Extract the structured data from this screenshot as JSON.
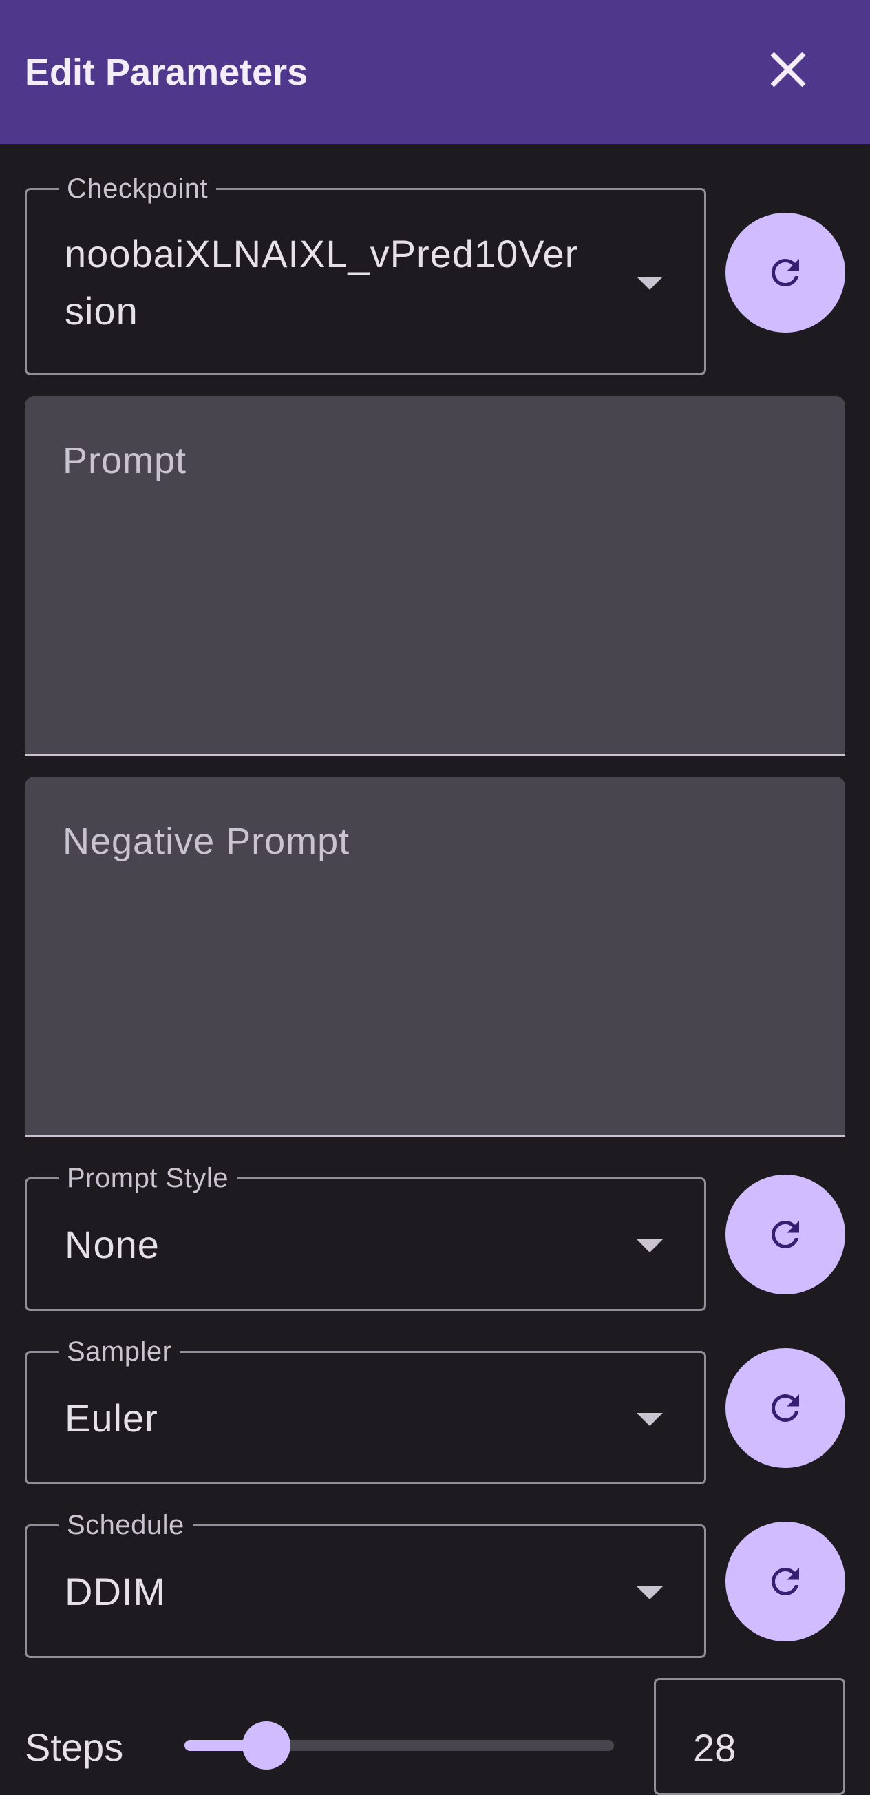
{
  "dialog": {
    "title": "Edit Parameters",
    "close_icon": "close-icon"
  },
  "checkpoint": {
    "label": "Checkpoint",
    "value_line1": "noobaiXLNAIXL_vPred10Ver",
    "value_line2": "sion"
  },
  "prompt": {
    "placeholder": "Prompt"
  },
  "negative_prompt": {
    "placeholder": "Negative Prompt"
  },
  "prompt_style": {
    "label": "Prompt Style",
    "value": "None"
  },
  "sampler": {
    "label": "Sampler",
    "value": "Euler"
  },
  "schedule": {
    "label": "Schedule",
    "value": "DDIM"
  },
  "steps": {
    "label": "Steps",
    "value": "28",
    "slider_fraction": 0.19
  },
  "colors": {
    "app_bar": "#4f378b",
    "background": "#1d1b20",
    "accent": "#d0bcff",
    "field_fill": "#49454f",
    "icon_dark": "#381e72"
  },
  "icons": {
    "refresh": "refresh-icon",
    "dropdown": "arrow-drop-down-icon"
  }
}
